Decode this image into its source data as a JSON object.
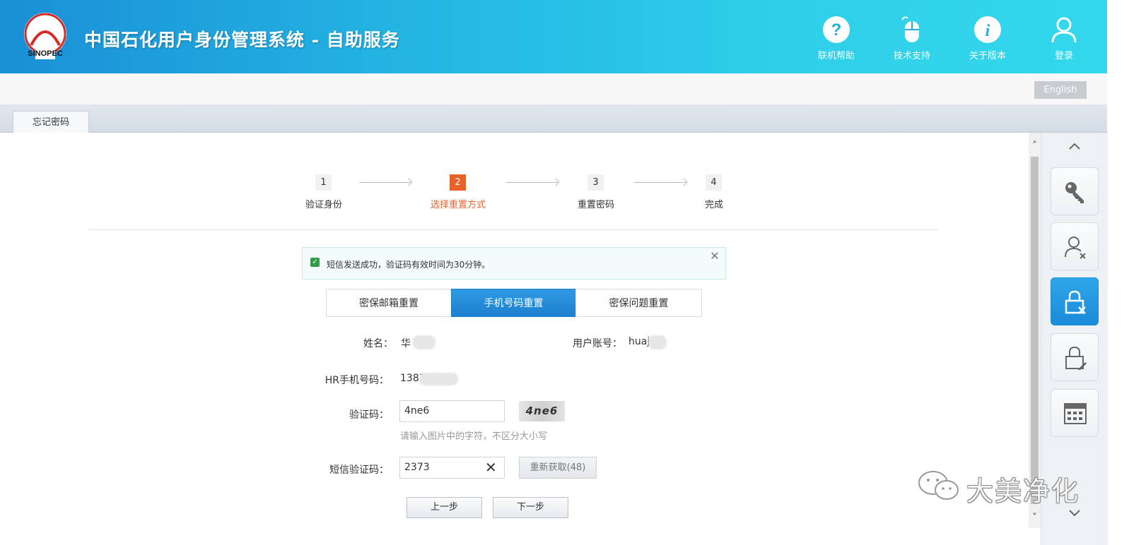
{
  "header": {
    "title": "中国石化用户身份管理系统 - 自助服务",
    "logo_text": "SINOPEC",
    "actions": [
      {
        "label": "联机帮助",
        "icon": "help-icon"
      },
      {
        "label": "技术支持",
        "icon": "mouse-icon"
      },
      {
        "label": "关于版本",
        "icon": "info-icon"
      },
      {
        "label": "登录",
        "icon": "user-icon"
      }
    ]
  },
  "language": {
    "label": "English"
  },
  "tabs": [
    {
      "label": "忘记密码"
    }
  ],
  "steps": [
    {
      "num": "1",
      "label": "验证身份"
    },
    {
      "num": "2",
      "label": "选择重置方式",
      "active": true
    },
    {
      "num": "3",
      "label": "重置密码"
    },
    {
      "num": "4",
      "label": "完成"
    }
  ],
  "notice": {
    "text": "短信发送成功，验证码有效时间为30分钟。",
    "close": "✕"
  },
  "reset_methods": [
    {
      "label": "密保邮箱重置"
    },
    {
      "label": "手机号码重置",
      "active": true
    },
    {
      "label": "密保问题重置"
    }
  ],
  "form": {
    "name_label": "姓名：",
    "name_value": "华",
    "account_label": "用户账号：",
    "account_value": "huaj",
    "phone_label": "HR手机号码：",
    "phone_value": "1383",
    "captcha_label": "验证码：",
    "captcha_value": "4ne6",
    "captcha_image_text": "4ne6",
    "captcha_hint": "请输入图片中的字符，不区分大小写",
    "sms_label": "短信验证码：",
    "sms_value": "2373",
    "resend_label": "重新获取(48)"
  },
  "buttons": {
    "prev": "上一步",
    "next": "下一步"
  },
  "sidebar_tools": [
    {
      "icon": "key-icon"
    },
    {
      "icon": "user-remove-icon"
    },
    {
      "icon": "lock-remove-icon",
      "active": true
    },
    {
      "icon": "lock-edit-icon"
    },
    {
      "icon": "calculator-icon"
    }
  ],
  "watermark": {
    "text": "大美净化"
  },
  "colors": {
    "header_start": "#1a8fd6",
    "header_end": "#33d8ec",
    "accent_orange": "#e8632c",
    "active_blue": "#1d80cf",
    "success_green": "#2e9e4a"
  }
}
